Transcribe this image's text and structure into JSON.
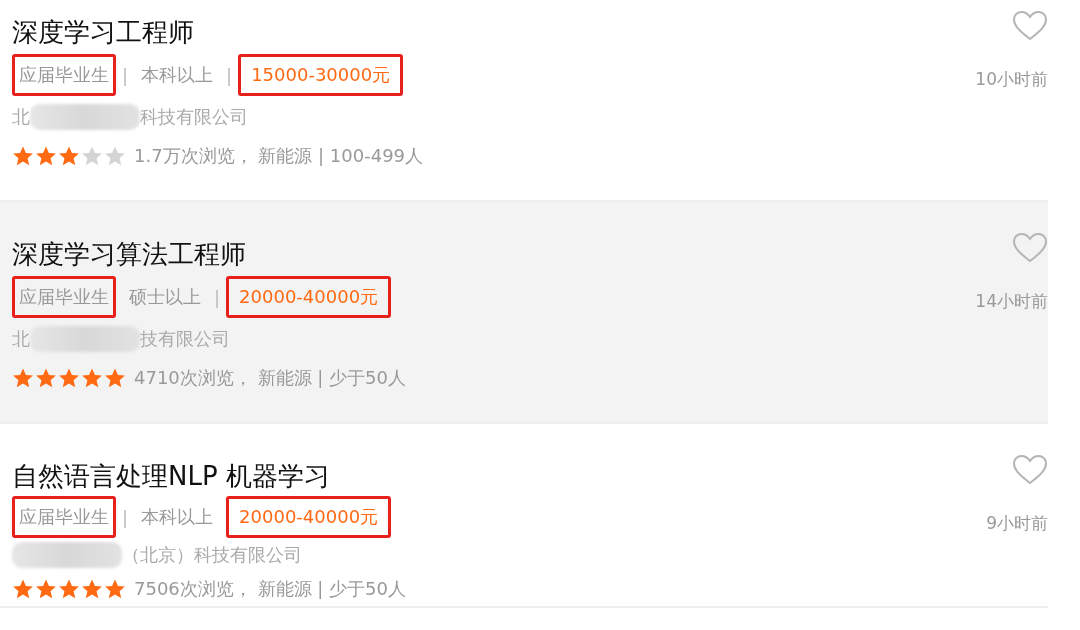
{
  "jobs": [
    {
      "title": "深度学习工程师",
      "shaded": false,
      "time": "10小时前",
      "meta": [
        {
          "kind": "tag",
          "text": "应届毕业生",
          "boxed": true
        },
        {
          "kind": "sep",
          "text": "|"
        },
        {
          "kind": "edu",
          "text": "本科以上"
        },
        {
          "kind": "sep",
          "text": "|"
        },
        {
          "kind": "salary",
          "text": "15000-30000元",
          "boxed": true
        }
      ],
      "company": {
        "before": "北",
        "after": "科技有限公司"
      },
      "stars": 3,
      "stats": "1.7万次浏览， 新能源 | 100-499人"
    },
    {
      "title": "深度学习算法工程师",
      "shaded": true,
      "time": "14小时前",
      "meta": [
        {
          "kind": "tag",
          "text": "应届毕业生",
          "boxed": true
        },
        {
          "kind": "edu",
          "text": "硕士以上"
        },
        {
          "kind": "sep",
          "text": "|"
        },
        {
          "kind": "salary",
          "text": "20000-40000元",
          "boxed": true
        }
      ],
      "company": {
        "before": "北",
        "after": "技有限公司"
      },
      "stars": 5,
      "stats": "4710次浏览， 新能源 | 少于50人"
    },
    {
      "title": "自然语言处理NLP 机器学习",
      "shaded": false,
      "time": "9小时前",
      "meta": [
        {
          "kind": "tag",
          "text": "应届毕业生",
          "boxed": true
        },
        {
          "kind": "sep",
          "text": "|"
        },
        {
          "kind": "edu",
          "text": "本科以上"
        },
        {
          "kind": "salary",
          "text": "20000-40000元",
          "boxed": true
        }
      ],
      "company": {
        "after": "（北京）科技有限公司"
      },
      "stars": 5,
      "stats": "7506次浏览， 新能源 | 少于50人"
    }
  ]
}
